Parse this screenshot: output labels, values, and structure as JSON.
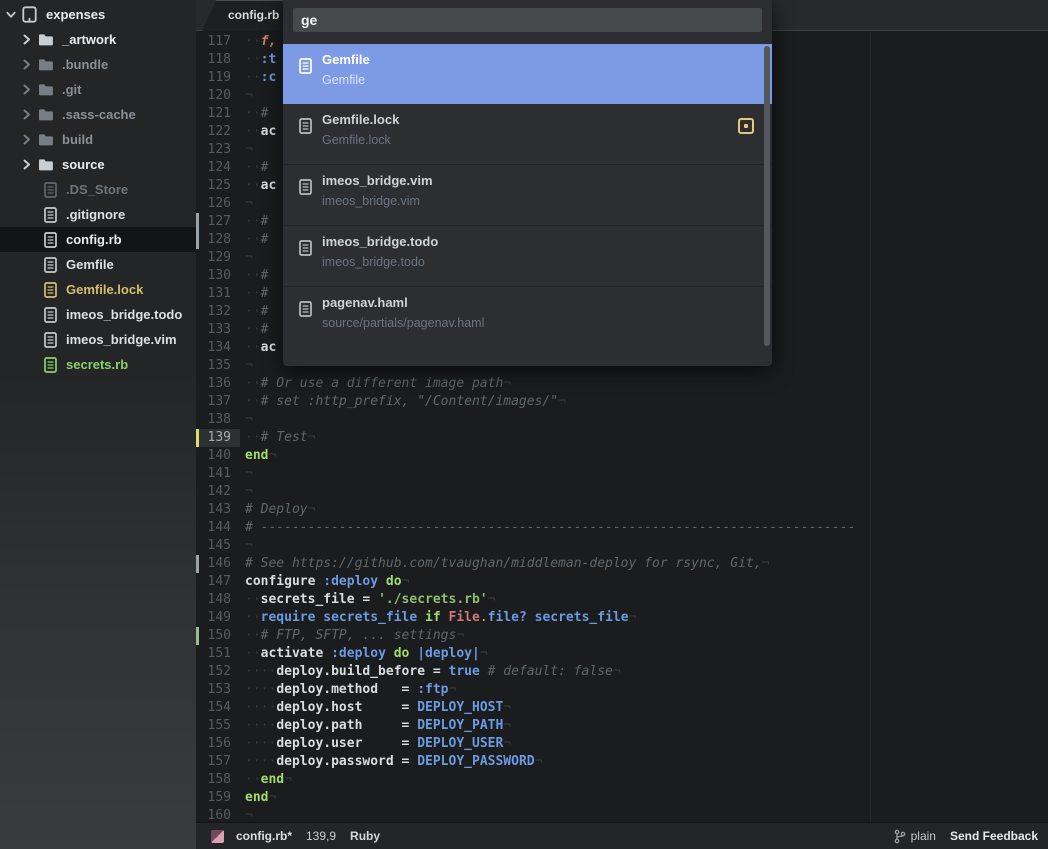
{
  "sidebar": {
    "root": {
      "label": "expenses",
      "icon": "book-icon",
      "chevron": "chevron-down-icon"
    },
    "items": [
      {
        "label": "_artwork",
        "kind": "folder",
        "tone": "bright"
      },
      {
        "label": ".bundle",
        "kind": "folder",
        "tone": "dim"
      },
      {
        "label": ".git",
        "kind": "folder",
        "tone": "dim"
      },
      {
        "label": ".sass-cache",
        "kind": "folder",
        "tone": "dim"
      },
      {
        "label": "build",
        "kind": "folder",
        "tone": "dim"
      },
      {
        "label": "source",
        "kind": "folder",
        "tone": "bright"
      },
      {
        "label": ".DS_Store",
        "kind": "file",
        "tone": "faint"
      },
      {
        "label": ".gitignore",
        "kind": "file",
        "tone": "normal"
      },
      {
        "label": "config.rb",
        "kind": "file",
        "tone": "bright",
        "selected": true
      },
      {
        "label": "Gemfile",
        "kind": "file",
        "tone": "normal"
      },
      {
        "label": "Gemfile.lock",
        "kind": "file",
        "tone": "gold"
      },
      {
        "label": "imeos_bridge.todo",
        "kind": "file",
        "tone": "normal"
      },
      {
        "label": "imeos_bridge.vim",
        "kind": "file",
        "tone": "normal"
      },
      {
        "label": "secrets.rb",
        "kind": "file",
        "tone": "green"
      }
    ]
  },
  "tabbar": {
    "active_tab": "config.rb"
  },
  "overlay": {
    "query": "ge",
    "results": [
      {
        "title": "Gemfile",
        "subtitle": "Gemfile",
        "selected": true,
        "badge": false
      },
      {
        "title": "Gemfile.lock",
        "subtitle": "Gemfile.lock",
        "selected": false,
        "badge": true
      },
      {
        "title": "imeos_bridge.vim",
        "subtitle": "imeos_bridge.vim",
        "selected": false,
        "badge": false
      },
      {
        "title": "imeos_bridge.todo",
        "subtitle": "imeos_bridge.todo",
        "selected": false,
        "badge": false
      },
      {
        "title": "pagenav.haml",
        "subtitle": "source/partials/pagenav.haml",
        "selected": false,
        "badge": false
      }
    ]
  },
  "editor": {
    "lines": [
      {
        "n": 117,
        "tokens": [
          [
            "··",
            "dim"
          ],
          [
            "f,",
            "ri"
          ]
        ]
      },
      {
        "n": 118,
        "tokens": [
          [
            "··",
            "dim"
          ],
          [
            ":t",
            "b"
          ]
        ]
      },
      {
        "n": 119,
        "tokens": [
          [
            "··",
            "dim"
          ],
          [
            ":c",
            "b"
          ]
        ]
      },
      {
        "n": 120,
        "tokens": [
          [
            "¬",
            "dim"
          ]
        ]
      },
      {
        "n": 121,
        "tokens": [
          [
            "··",
            "dim"
          ],
          [
            "# ",
            "c"
          ]
        ]
      },
      {
        "n": 122,
        "tokens": [
          [
            "··",
            "dim"
          ],
          [
            "ac",
            "w"
          ]
        ]
      },
      {
        "n": 123,
        "tokens": [
          [
            "¬",
            "dim"
          ]
        ]
      },
      {
        "n": 124,
        "tokens": [
          [
            "··",
            "dim"
          ],
          [
            "# ",
            "c"
          ]
        ]
      },
      {
        "n": 125,
        "tokens": [
          [
            "··",
            "dim"
          ],
          [
            "ac",
            "w"
          ]
        ]
      },
      {
        "n": 126,
        "tokens": [
          [
            "¬",
            "dim"
          ]
        ]
      },
      {
        "n": 127,
        "marker": "gray",
        "tokens": [
          [
            "··",
            "dim"
          ],
          [
            "# ",
            "c"
          ]
        ]
      },
      {
        "n": 128,
        "marker": "gray",
        "tokens": [
          [
            "··",
            "dim"
          ],
          [
            "# ",
            "c"
          ]
        ]
      },
      {
        "n": 129,
        "tokens": [
          [
            "¬",
            "dim"
          ]
        ]
      },
      {
        "n": 130,
        "tokens": [
          [
            "··",
            "dim"
          ],
          [
            "# ",
            "c"
          ]
        ]
      },
      {
        "n": 131,
        "tokens": [
          [
            "··",
            "dim"
          ],
          [
            "# ",
            "c"
          ]
        ]
      },
      {
        "n": 132,
        "tokens": [
          [
            "··",
            "dim"
          ],
          [
            "# ",
            "c"
          ]
        ]
      },
      {
        "n": 133,
        "tokens": [
          [
            "··",
            "dim"
          ],
          [
            "# ",
            "c"
          ]
        ]
      },
      {
        "n": 134,
        "tokens": [
          [
            "··",
            "dim"
          ],
          [
            "ac",
            "w"
          ]
        ]
      },
      {
        "n": 135,
        "tokens": [
          [
            "¬",
            "dim"
          ]
        ]
      },
      {
        "n": 136,
        "tokens": [
          [
            "··",
            "dim"
          ],
          [
            "# Or use a different image path",
            "c"
          ],
          [
            "¬",
            "dim"
          ]
        ]
      },
      {
        "n": 137,
        "tokens": [
          [
            "··",
            "dim"
          ],
          [
            "# set :http_prefix, \"/Content/images/\"",
            "c"
          ],
          [
            "¬",
            "dim"
          ]
        ]
      },
      {
        "n": 138,
        "tokens": [
          [
            "¬",
            "dim"
          ]
        ]
      },
      {
        "n": 139,
        "current": true,
        "tokens": [
          [
            "··",
            "dim"
          ],
          [
            "# Test",
            "c"
          ],
          [
            "¬",
            "dim"
          ]
        ]
      },
      {
        "n": 140,
        "tokens": [
          [
            "end",
            "k"
          ],
          [
            "¬",
            "dim"
          ]
        ]
      },
      {
        "n": 141,
        "tokens": [
          [
            "¬",
            "dim"
          ]
        ]
      },
      {
        "n": 142,
        "tokens": [
          [
            "¬",
            "dim"
          ]
        ]
      },
      {
        "n": 143,
        "tokens": [
          [
            "# Deploy",
            "c"
          ],
          [
            "¬",
            "dim"
          ]
        ]
      },
      {
        "n": 144,
        "tokens": [
          [
            "# ----------------------------------------------------------------------------",
            "c"
          ]
        ]
      },
      {
        "n": 145,
        "tokens": [
          [
            "¬",
            "dim"
          ]
        ]
      },
      {
        "n": 146,
        "marker": "gray",
        "tokens": [
          [
            "# See https://github.com/tvaughan/middleman-deploy for rsync, Git,",
            "c"
          ],
          [
            "¬",
            "dim"
          ]
        ]
      },
      {
        "n": 147,
        "tokens": [
          [
            "configure ",
            "w"
          ],
          [
            ":deploy ",
            "b"
          ],
          [
            "do",
            "k"
          ],
          [
            "¬",
            "dim"
          ]
        ]
      },
      {
        "n": 148,
        "tokens": [
          [
            "··",
            "dim"
          ],
          [
            "secrets_file = ",
            "w"
          ],
          [
            "'./secrets.rb'",
            "s"
          ],
          [
            "¬",
            "dim"
          ]
        ]
      },
      {
        "n": 149,
        "tokens": [
          [
            "··",
            "dim"
          ],
          [
            "require secrets_file ",
            "b"
          ],
          [
            "if ",
            "k"
          ],
          [
            "File",
            "r"
          ],
          [
            ".",
            "p"
          ],
          [
            "file? ",
            "b"
          ],
          [
            "secrets_file",
            "b"
          ],
          [
            "¬",
            "dim"
          ]
        ]
      },
      {
        "n": 150,
        "marker": "green",
        "tokens": [
          [
            "··",
            "dim"
          ],
          [
            "# FTP, SFTP, ... settings",
            "c"
          ],
          [
            "¬",
            "dim"
          ]
        ]
      },
      {
        "n": 151,
        "tokens": [
          [
            "··",
            "dim"
          ],
          [
            "activate ",
            "w"
          ],
          [
            ":deploy ",
            "b"
          ],
          [
            "do ",
            "k"
          ],
          [
            "|deploy|",
            "b"
          ],
          [
            "¬",
            "dim"
          ]
        ]
      },
      {
        "n": 152,
        "tokens": [
          [
            "····",
            "dim"
          ],
          [
            "deploy.build_before = ",
            "w"
          ],
          [
            "true ",
            "b"
          ],
          [
            "# default: false",
            "c"
          ],
          [
            "¬",
            "dim"
          ]
        ]
      },
      {
        "n": 153,
        "tokens": [
          [
            "····",
            "dim"
          ],
          [
            "deploy.method   = ",
            "w"
          ],
          [
            ":ftp",
            "b"
          ],
          [
            "¬",
            "dim"
          ]
        ]
      },
      {
        "n": 154,
        "tokens": [
          [
            "····",
            "dim"
          ],
          [
            "deploy.host     = ",
            "w"
          ],
          [
            "DEPLOY_HOST",
            "b"
          ],
          [
            "¬",
            "dim"
          ]
        ]
      },
      {
        "n": 155,
        "tokens": [
          [
            "····",
            "dim"
          ],
          [
            "deploy.path     = ",
            "w"
          ],
          [
            "DEPLOY_PATH",
            "b"
          ],
          [
            "¬",
            "dim"
          ]
        ]
      },
      {
        "n": 156,
        "tokens": [
          [
            "····",
            "dim"
          ],
          [
            "deploy.user     = ",
            "w"
          ],
          [
            "DEPLOY_USER",
            "b"
          ],
          [
            "¬",
            "dim"
          ]
        ]
      },
      {
        "n": 157,
        "tokens": [
          [
            "····",
            "dim"
          ],
          [
            "deploy.password = ",
            "w"
          ],
          [
            "DEPLOY_PASSWORD",
            "b"
          ],
          [
            "¬",
            "dim"
          ]
        ]
      },
      {
        "n": 158,
        "tokens": [
          [
            "··",
            "dim"
          ],
          [
            "end",
            "k"
          ],
          [
            "¬",
            "dim"
          ]
        ]
      },
      {
        "n": 159,
        "tokens": [
          [
            "end",
            "k"
          ],
          [
            "¬",
            "dim"
          ]
        ]
      },
      {
        "n": 160,
        "tokens": [
          [
            "¬",
            "dim"
          ]
        ]
      }
    ]
  },
  "statusbar": {
    "modified_file": "config.rb*",
    "cursor_position": "139,9",
    "language": "Ruby",
    "branch": "plain",
    "feedback": "Send Feedback"
  },
  "colors": {
    "accent_blue": "#7d9ae4",
    "current_line_marker": "#d5e06e",
    "marker_gray": "#9aa2aa",
    "marker_green": "#9cbb90",
    "gold": "#d8bd6f",
    "green": "#8bd06a",
    "badge_yellow": "#e3c87e"
  }
}
